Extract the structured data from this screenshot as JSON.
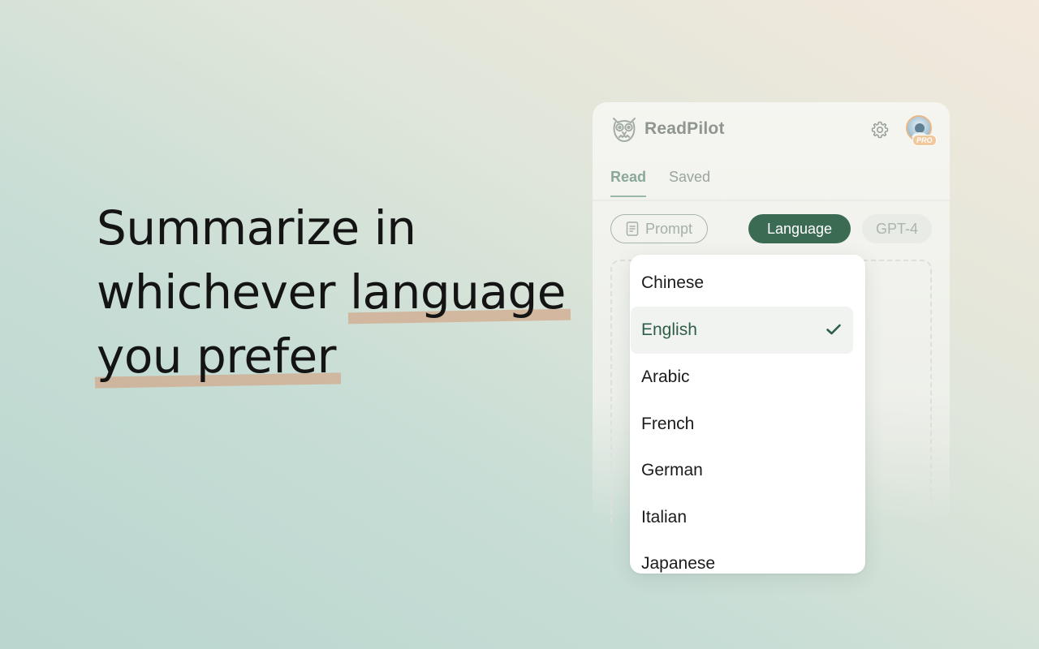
{
  "headline": {
    "line1": "Summarize in",
    "line2_plain": "whichever ",
    "line2_highlight": "language",
    "line3_highlight": "you prefer"
  },
  "panel": {
    "brand_name": "ReadPilot",
    "brand_icon": "owl-icon",
    "settings_icon": "gear-icon",
    "avatar_badge": "PRO",
    "tabs": [
      {
        "label": "Read",
        "active": true
      },
      {
        "label": "Saved",
        "active": false
      }
    ],
    "prompt_label": "Prompt",
    "language_label": "Language",
    "model_label": "GPT-4"
  },
  "dropdown": {
    "options": [
      "Chinese",
      "English",
      "Arabic",
      "French",
      "German",
      "Italian",
      "Japanese"
    ],
    "selected": "English"
  },
  "colors": {
    "accent": "#3c6b54",
    "highlight": "#d2aa8c",
    "selected_text": "#2f5e47"
  }
}
